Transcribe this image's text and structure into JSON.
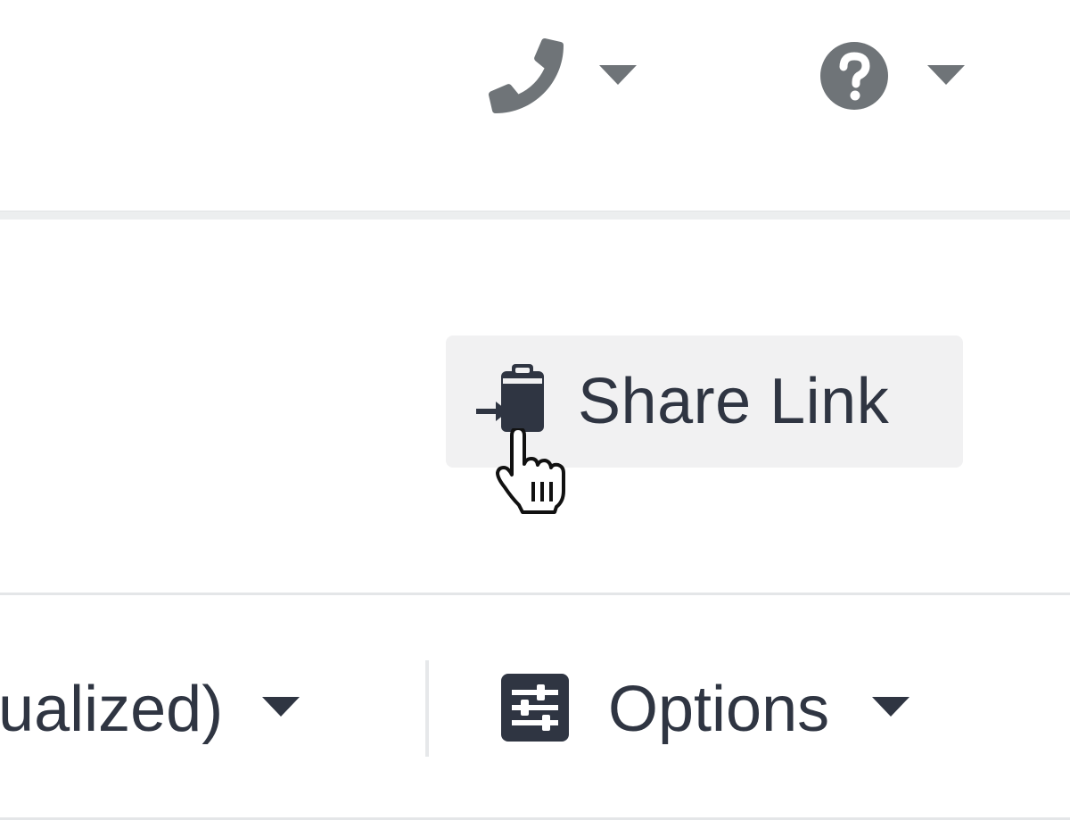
{
  "header": {
    "phone": {
      "icon": "phone-icon",
      "caret": "chevron-down-icon"
    },
    "help": {
      "icon": "question-circle-icon",
      "caret": "chevron-down-icon"
    }
  },
  "share": {
    "label": "Share Link",
    "icon": "clipboard-paste-icon"
  },
  "toolbar": {
    "mode_label": "nualized)",
    "options_label": "Options",
    "options_icon": "sliders-icon"
  },
  "colors": {
    "text": "#2f3542",
    "icon_gray": "#6f7478",
    "button_bg": "#f1f1f2",
    "divider": "#e4e6e8"
  }
}
